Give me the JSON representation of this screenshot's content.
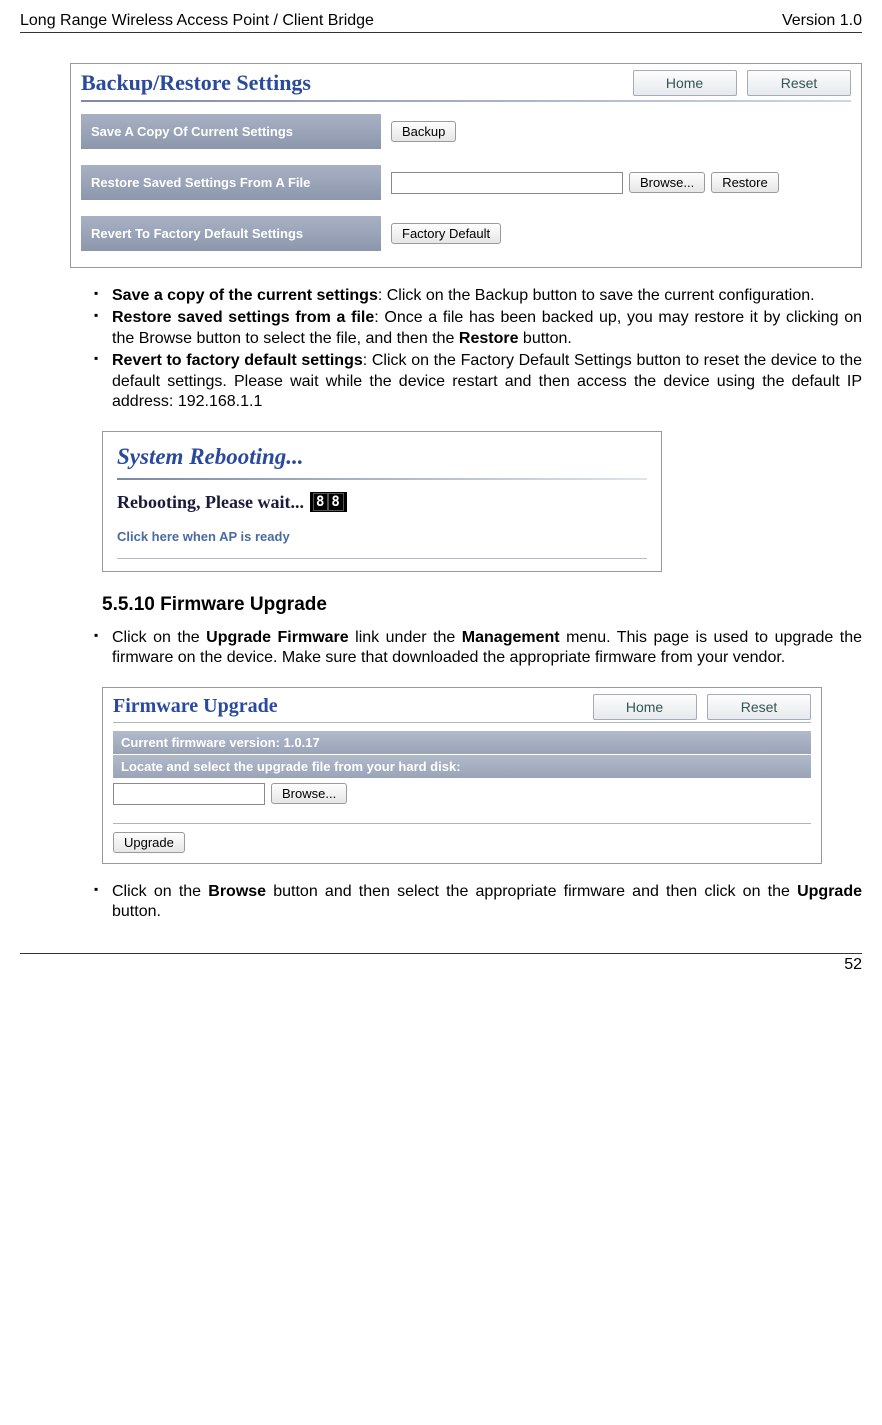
{
  "header": {
    "left": "Long Range Wireless Access Point / Client Bridge",
    "right": "Version 1.0"
  },
  "backup_panel": {
    "title": "Backup/Restore Settings",
    "home_btn": "Home",
    "reset_btn": "Reset",
    "row1_label": "Save A Copy Of Current Settings",
    "row1_btn": "Backup",
    "row2_label": "Restore Saved Settings From A File",
    "row2_browse": "Browse...",
    "row2_restore": "Restore",
    "row3_label": "Revert To Factory Default Settings",
    "row3_btn": "Factory Default"
  },
  "bullets1": {
    "b1_bold": "Save a copy of the current settings",
    "b1_rest": ": Click on the Backup button to save the current configuration.",
    "b2_bold": "Restore saved settings from a file",
    "b2_mid": ": Once a file has been backed up, you may restore it by clicking on the Browse button to select the file, and then the ",
    "b2_bold2": "Restore",
    "b2_end": " button.",
    "b3_bold": "Revert to factory default settings",
    "b3_rest": ": Click on the Factory Default Settings button to reset the device to the default settings. Please wait while the device restart and then access the device using the default IP address: 192.168.1.1"
  },
  "reboot": {
    "title": "System Rebooting...",
    "msg": "Rebooting, Please wait...",
    "count": "88",
    "link": "Click here when AP is ready"
  },
  "section_heading": "5.5.10 Firmware Upgrade",
  "bullets2": {
    "pre": "Click on the ",
    "bold1": "Upgrade Firmware",
    "mid": " link under the ",
    "bold2": "Management",
    "end": " menu. This page is used to upgrade the firmware on the device. Make sure that downloaded the appropriate firmware from your vendor."
  },
  "fw_panel": {
    "title": "Firmware Upgrade",
    "home_btn": "Home",
    "reset_btn": "Reset",
    "version_row": "Current firmware version: 1.0.17",
    "locate_row": "Locate and select the upgrade file from your hard disk:",
    "browse_btn": "Browse...",
    "upgrade_btn": "Upgrade"
  },
  "bullets3": {
    "pre": "Click on the ",
    "bold1": "Browse",
    "mid": " button and then select the appropriate firmware and then click on the ",
    "bold2": "Upgrade",
    "end": " button."
  },
  "footer": {
    "page": "52"
  }
}
